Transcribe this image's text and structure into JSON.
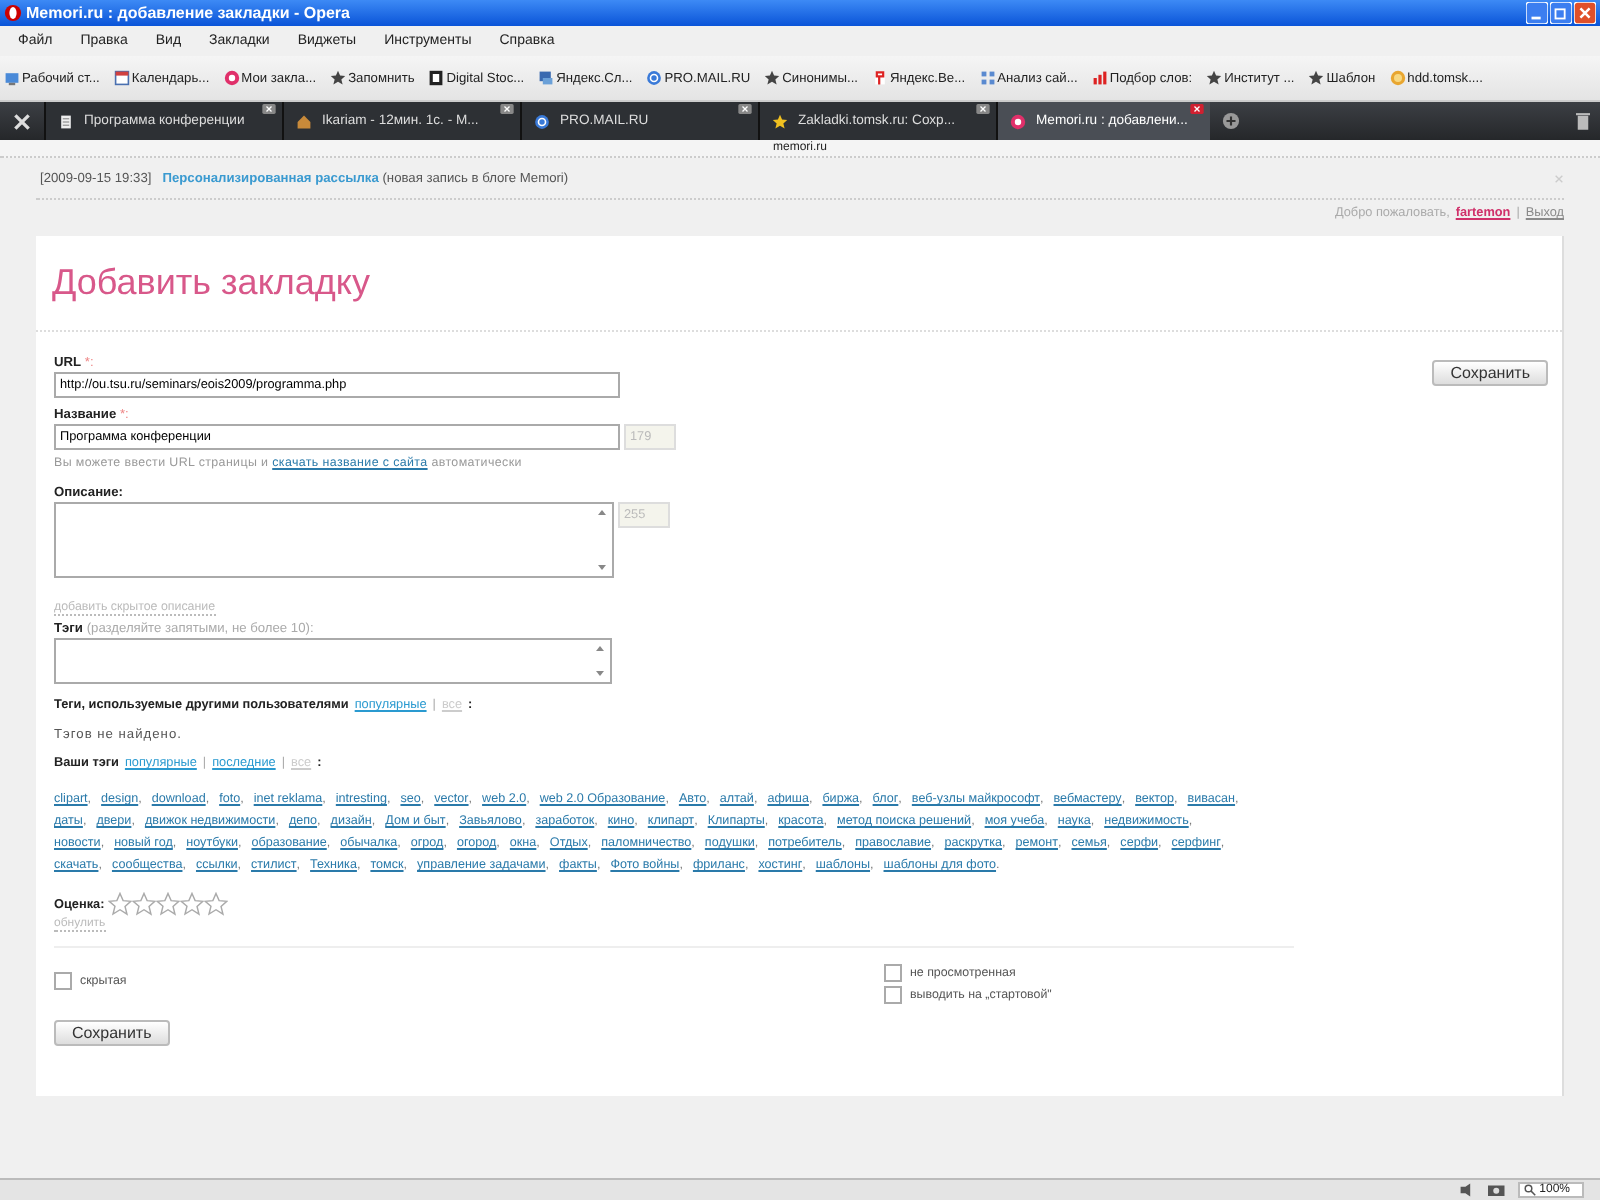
{
  "window": {
    "title": "Memori.ru : добавление закладки - Opera"
  },
  "menu": [
    "Файл",
    "Правка",
    "Вид",
    "Закладки",
    "Виджеты",
    "Инструменты",
    "Справка"
  ],
  "bookmarks": [
    {
      "label": "Рабочий ст...",
      "kind": "desktop"
    },
    {
      "label": "Календарь...",
      "kind": "calendar"
    },
    {
      "label": "Мои закла...",
      "kind": "badge"
    },
    {
      "label": "Запомнить",
      "kind": "star"
    },
    {
      "label": "Digital Stoc...",
      "kind": "square"
    },
    {
      "label": "Яндекс.Сл...",
      "kind": "monitor"
    },
    {
      "label": "PRO.MAIL.RU",
      "kind": "globe"
    },
    {
      "label": "Синонимы...",
      "kind": "star"
    },
    {
      "label": "Яндекс.Ве...",
      "kind": "flag"
    },
    {
      "label": "Анализ сай...",
      "kind": "grid"
    },
    {
      "label": "Подбор слов:",
      "kind": "bars"
    },
    {
      "label": "Институт ...",
      "kind": "star"
    },
    {
      "label": "Шаблон",
      "kind": "star"
    },
    {
      "label": "hdd.tomsk....",
      "kind": "coin"
    }
  ],
  "tabs": [
    {
      "label": "Программа конференции",
      "kind": "page",
      "selected": false
    },
    {
      "label": "Ikariam - 12мин. 1с. - М...",
      "kind": "house",
      "selected": false
    },
    {
      "label": "PRO.MAIL.RU",
      "kind": "globe",
      "selected": false
    },
    {
      "label": "Zakladki.tomsk.ru: Сохр...",
      "kind": "star",
      "selected": false
    },
    {
      "label": "Memori.ru : добавлени...",
      "kind": "badge",
      "selected": true
    }
  ],
  "address": "memori.ru",
  "notice": {
    "date": "[2009-09-15 19:33]",
    "link": "Персонализированная рассылка",
    "note": "(новая запись в блоге Memori)"
  },
  "user": {
    "greeting": "Добро пожаловать,",
    "name": "fartemon",
    "separator": "|",
    "logout": "Выход"
  },
  "heading": "Добавить закладку",
  "url": {
    "label": "URL",
    "required": "*:",
    "value": "http://ou.tsu.ru/seminars/eois2009/programma.php"
  },
  "save_top": "Сохранить",
  "title_field": {
    "label": "Название",
    "required": "*:",
    "value": "Программа конференции",
    "counter": "179",
    "hint_before": "Вы можете ввести URL страницы и",
    "hint_link": "скачать название с сайта",
    "hint_after": "автоматически"
  },
  "description": {
    "label": "Описание:",
    "counter": "255",
    "hidden_link": "добавить скрытое описание"
  },
  "tags_field": {
    "label": "Тэги",
    "hint": "(разделяйте запятыми, не более 10):"
  },
  "others_tags": {
    "label": "Теги, используемые другими пользователями",
    "separator": "|",
    "end": ":",
    "links": [
      {
        "text": "популярные",
        "selected": false
      },
      {
        "text": "все",
        "selected": true
      }
    ],
    "empty": "Тэгов не найдено."
  },
  "my_tags": {
    "label": "Ваши тэги",
    "separator": "|",
    "end": ":",
    "links": [
      {
        "text": "популярные",
        "selected": false
      },
      {
        "text": "последние",
        "selected": false
      },
      {
        "text": "все",
        "selected": true
      }
    ],
    "tag_separator": ",",
    "tag_end": ".",
    "lines": [
      [
        "clipart",
        "design",
        "download",
        "foto",
        "inet reklama",
        "intresting",
        "seo",
        "vector",
        "web 2.0",
        "web 2.0 Образование",
        "Авто",
        "алтай",
        "афиша",
        "биржа",
        "блог",
        "веб-узлы майкрософт",
        "вебмастеру",
        "вектор",
        "вивасан"
      ],
      [
        "даты",
        "двери",
        "движок недвижимости",
        "депо",
        "дизайн",
        "Дом и быт",
        "Завьялово",
        "заработок",
        "кино",
        "клипарт",
        "Клипарты",
        "красота",
        "метод поиска решений",
        "моя учеба",
        "наука",
        "недвижимость"
      ],
      [
        "новости",
        "новый год",
        "ноутбуки",
        "образование",
        "обычалка",
        "огрод",
        "огород",
        "окна",
        "Отдых",
        "паломничество",
        "подушки",
        "потребитель",
        "православие",
        "раскрутка",
        "ремонт",
        "семья",
        "серфи",
        "серфинг"
      ],
      [
        "скачать",
        "сообщества",
        "ссылки",
        "стилист",
        "Техника",
        "томск",
        "управление задачами",
        "факты",
        "Фото войны",
        "фриланс",
        "хостинг",
        "шаблоны",
        "шаблоны для фото"
      ]
    ]
  },
  "rating": {
    "label": "Оценка:",
    "stars": 0,
    "reset": "обнулить"
  },
  "options_left": [
    {
      "label": "скрытая",
      "checked": false
    }
  ],
  "options_right": [
    {
      "label": "не просмотренная",
      "checked": false
    },
    {
      "label": "выводить на „стартовой\"",
      "checked": false
    }
  ],
  "save_bottom": "Сохранить",
  "status": {
    "zoom": "100%"
  }
}
